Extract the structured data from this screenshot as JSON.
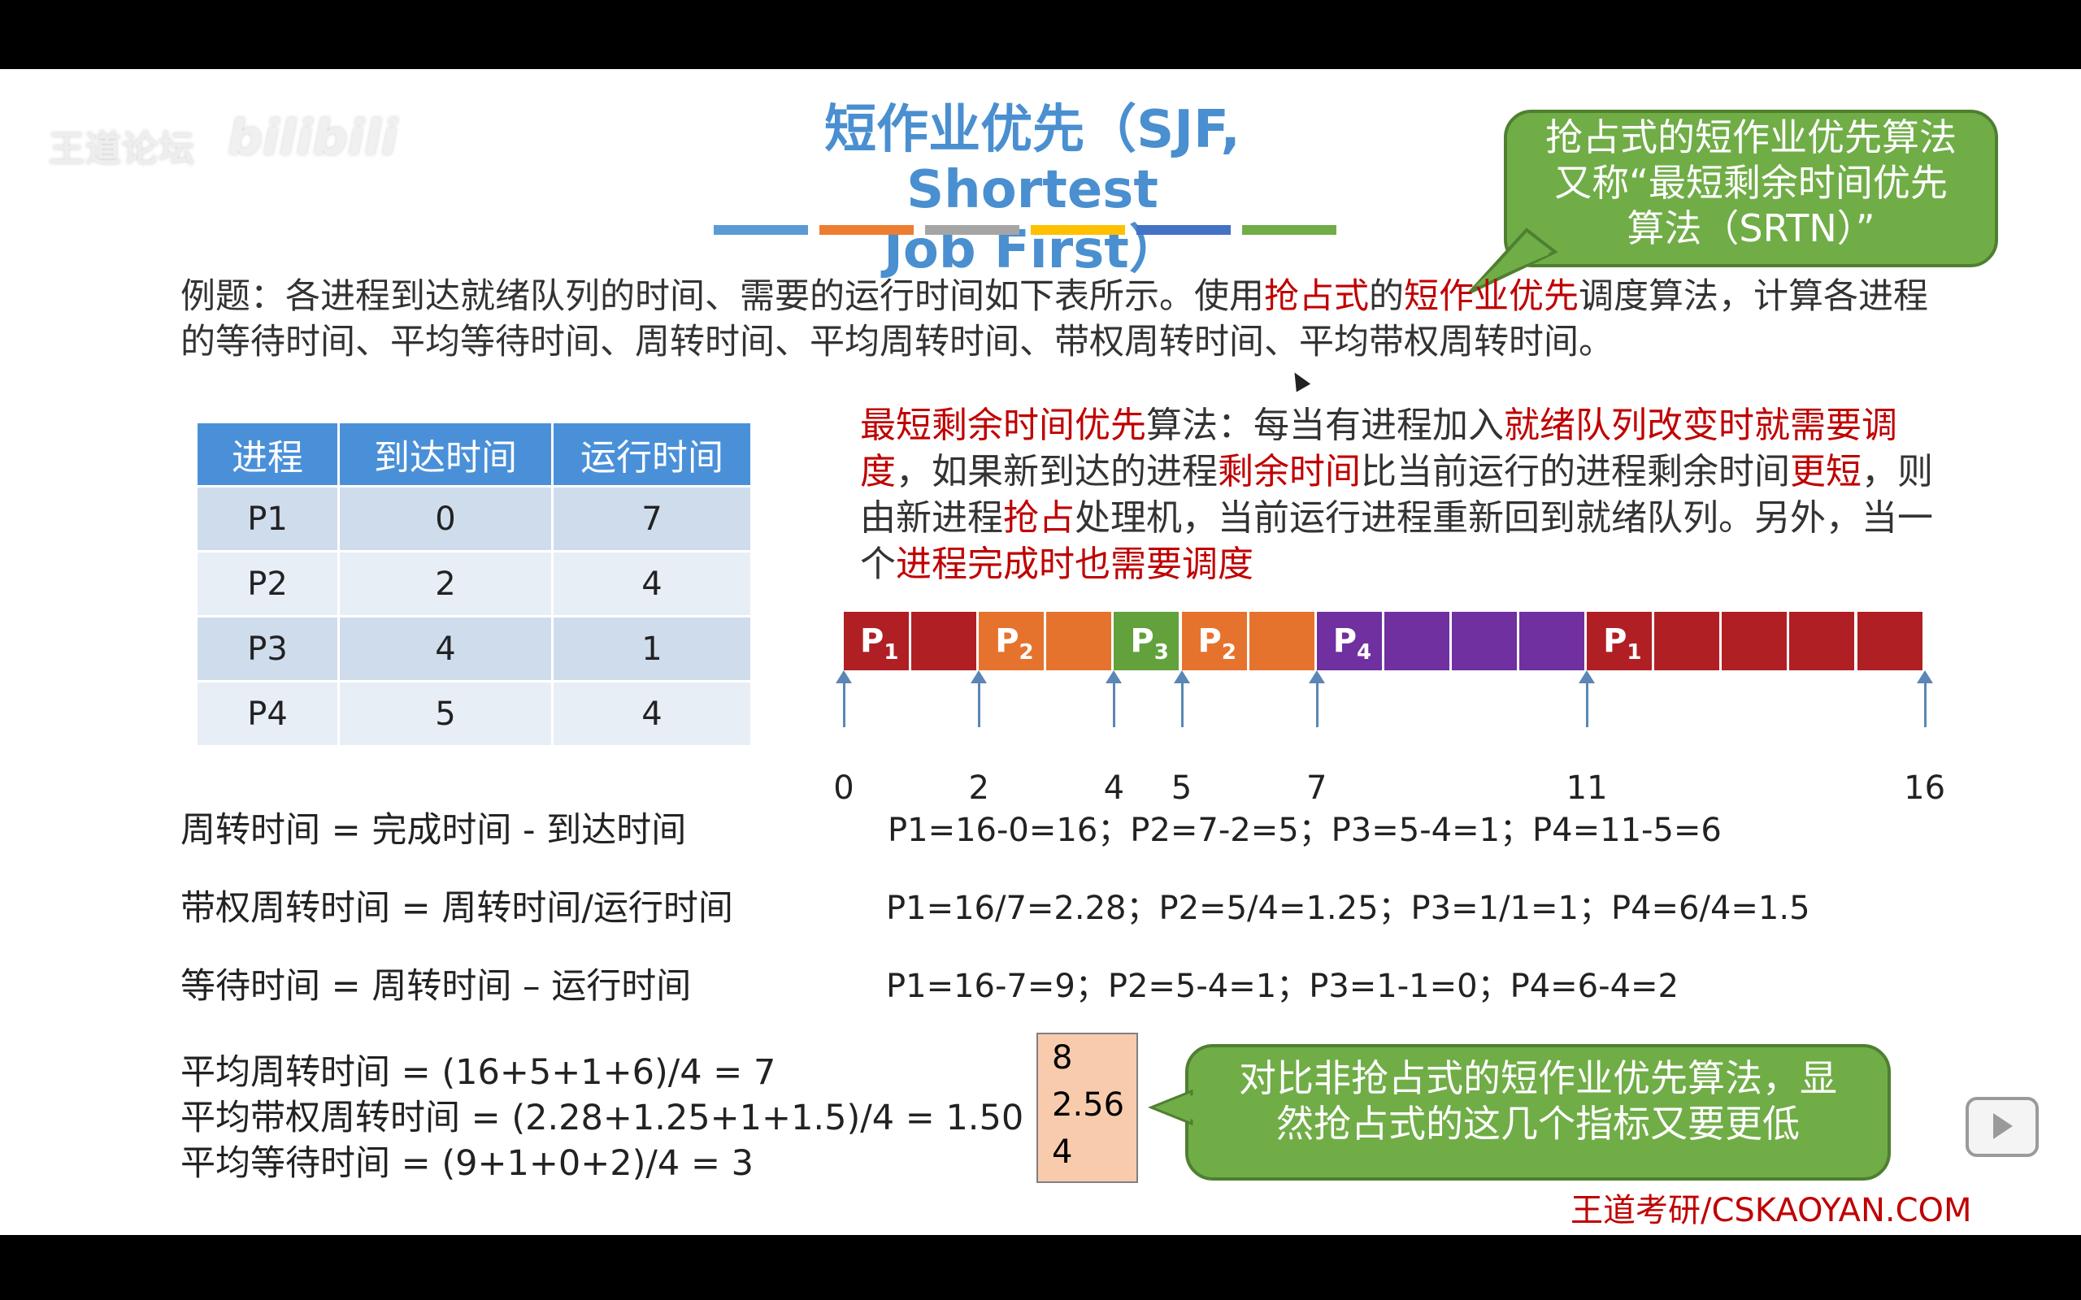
{
  "watermark": {
    "text": "王道论坛",
    "logo": "bilibili"
  },
  "title": {
    "line1": "短作业优先（SJF, Shortest",
    "line2": "Job First）"
  },
  "title_bar_colors": [
    "#5b9bd5",
    "#ed7d31",
    "#a5a5a5",
    "#ffc000",
    "#4472c4",
    "#70ad47"
  ],
  "callout_top": {
    "line1": "抢占式的短作业优先算法",
    "line2": "又称“最短剩余时间优先",
    "line3": "算法（SRTN）”"
  },
  "question": {
    "p1": "例题：各进程到达就绪队列的时间、需要的运行时间如下表所示。使用",
    "r1": "抢占式",
    "p2": "的",
    "r2": "短作业优先",
    "p3": "调度算法，计算各进程的等待时间、平均等待时间、周转时间、平均周转时间、带权周转时间、平均带权周转时间。"
  },
  "table": {
    "headers": [
      "进程",
      "到达时间",
      "运行时间"
    ],
    "rows": [
      [
        "P1",
        "0",
        "7"
      ],
      [
        "P2",
        "2",
        "4"
      ],
      [
        "P3",
        "4",
        "1"
      ],
      [
        "P4",
        "5",
        "4"
      ]
    ]
  },
  "srtn": {
    "r1": "最短剩余时间优先",
    "p1": "算法：每当有进程加入",
    "r2": "就绪队列改变时就需要调度",
    "p2": "，如果新到达的进程",
    "r3": "剩余时间",
    "p3": "比当前运行的进程剩余时间",
    "r4": "更短",
    "p4": "，则由新进程",
    "r5": "抢占",
    "p5": "处理机，当前运行进程重新回到就绪队列。另外，当一个",
    "r6": "进程完成时也需要调度"
  },
  "gantt": {
    "segments": [
      {
        "proc": "P",
        "sub": "1",
        "start": 0,
        "end": 2,
        "color": "#b01f24"
      },
      {
        "proc": "P",
        "sub": "2",
        "start": 2,
        "end": 4,
        "color": "#e6732d"
      },
      {
        "proc": "P",
        "sub": "3",
        "start": 4,
        "end": 5,
        "color": "#62a13c"
      },
      {
        "proc": "P",
        "sub": "2",
        "start": 5,
        "end": 7,
        "color": "#e6732d"
      },
      {
        "proc": "P",
        "sub": "4",
        "start": 7,
        "end": 11,
        "color": "#7030a0"
      },
      {
        "proc": "P",
        "sub": "1",
        "start": 11,
        "end": 16,
        "color": "#b01f24"
      }
    ],
    "ticks": [
      "0",
      "2",
      "4",
      "5",
      "7",
      "11",
      "16"
    ]
  },
  "formulas": {
    "turnaround": "周转时间 = 完成时间 - 到达时间",
    "weighted": "带权周转时间 = 周转时间/运行时间",
    "waiting": "等待时间 = 周转时间 – 运行时间",
    "turnaround_calc": "P1=16-0=16；P2=7-2=5；P3=5-4=1；P4=11-5=6",
    "weighted_calc": "P1=16/7=2.28；P2=5/4=1.25；P3=1/1=1；P4=6/4=1.5",
    "waiting_calc": "P1=16-7=9；P2=5-4=1；P3=1-1=0；P4=6-4=2"
  },
  "averages": {
    "turnaround": "平均周转时间 = (16+5+1+6)/4 = 7",
    "weighted": "平均带权周转时间 = (2.28+1.25+1+1.5)/4 = 1.50",
    "waiting": "平均等待时间 = (9+1+0+2)/4 = 3"
  },
  "compare_box": [
    "8",
    "2.56",
    "4"
  ],
  "callout_bottom": {
    "line1": "对比非抢占式的短作业优先算法，显",
    "line2": "然抢占式的这几个指标又要更低"
  },
  "brand": "王道考研/CSKAOYAN.COM"
}
